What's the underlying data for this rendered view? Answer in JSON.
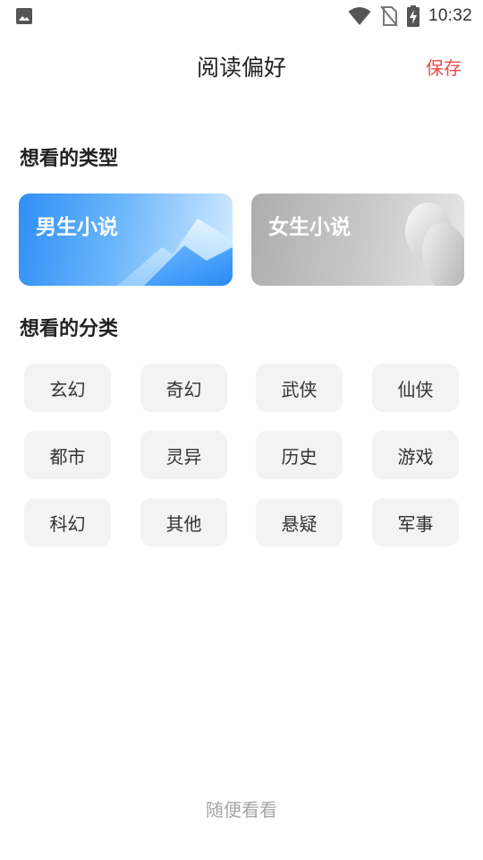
{
  "status_bar": {
    "time": "10:32",
    "icons": [
      "gallery-icon",
      "wifi-icon",
      "no-sim-icon",
      "battery-charging-icon"
    ]
  },
  "header": {
    "title": "阅读偏好",
    "save_label": "保存"
  },
  "types_section": {
    "title": "想看的类型",
    "cards": [
      {
        "label": "男生小说"
      },
      {
        "label": "女生小说"
      }
    ]
  },
  "categories_section": {
    "title": "想看的分类",
    "items": [
      {
        "label": "玄幻"
      },
      {
        "label": "奇幻"
      },
      {
        "label": "武侠"
      },
      {
        "label": "仙侠"
      },
      {
        "label": "都市"
      },
      {
        "label": "灵异"
      },
      {
        "label": "历史"
      },
      {
        "label": "游戏"
      },
      {
        "label": "科幻"
      },
      {
        "label": "其他"
      },
      {
        "label": "悬疑"
      },
      {
        "label": "军事"
      }
    ]
  },
  "footer": {
    "browse_label": "随便看看"
  },
  "colors": {
    "accent": "#e94b4b",
    "male_card": "#2f8ff5",
    "female_card": "#b5b5b5",
    "chip_bg": "#f3f3f3",
    "muted": "#a6a6a6"
  }
}
